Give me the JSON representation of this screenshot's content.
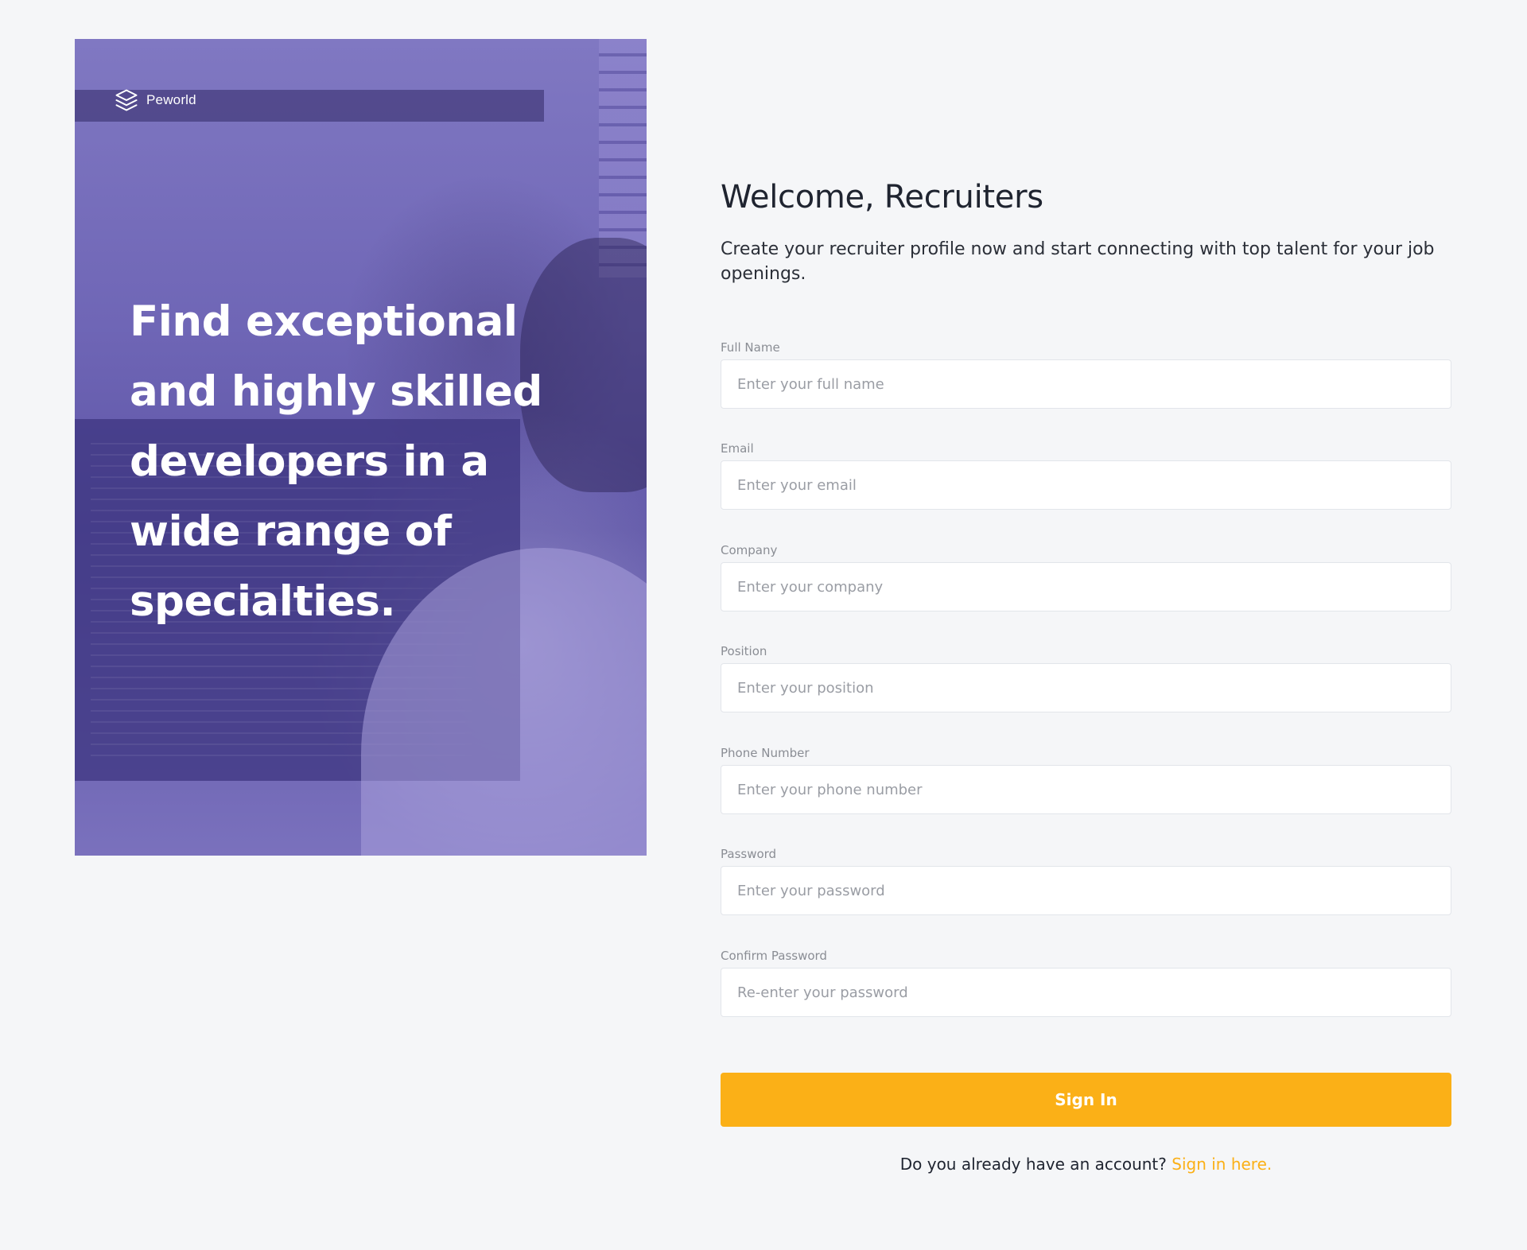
{
  "brand": {
    "name": "Peworld",
    "logo_icon": "layers-icon"
  },
  "hero": {
    "headline": "Find exceptional and highly skilled developers in a wide range of specialties."
  },
  "form": {
    "title": "Welcome, Recruiters",
    "subtitle": "Create your recruiter profile now and start connecting with top talent for your job openings.",
    "fields": [
      {
        "label": "Full Name",
        "placeholder": "Enter your full name",
        "value": ""
      },
      {
        "label": "Email",
        "placeholder": "Enter your email",
        "value": ""
      },
      {
        "label": "Company",
        "placeholder": "Enter your company",
        "value": ""
      },
      {
        "label": "Position",
        "placeholder": "Enter your position",
        "value": ""
      },
      {
        "label": "Phone Number",
        "placeholder": "Enter your phone number",
        "value": ""
      },
      {
        "label": "Password",
        "placeholder": "Enter your password",
        "value": ""
      },
      {
        "label": "Confirm Password",
        "placeholder": "Re-enter your password",
        "value": ""
      }
    ],
    "submit_label": "Sign In",
    "account_prompt": "Do you already have an account?",
    "account_link": "Sign in here."
  },
  "colors": {
    "background": "#f5f6f8",
    "hero_overlay": "#6a5fb0",
    "accent": "#fbb017",
    "text": "#1f2430",
    "label": "#8a8d94"
  }
}
